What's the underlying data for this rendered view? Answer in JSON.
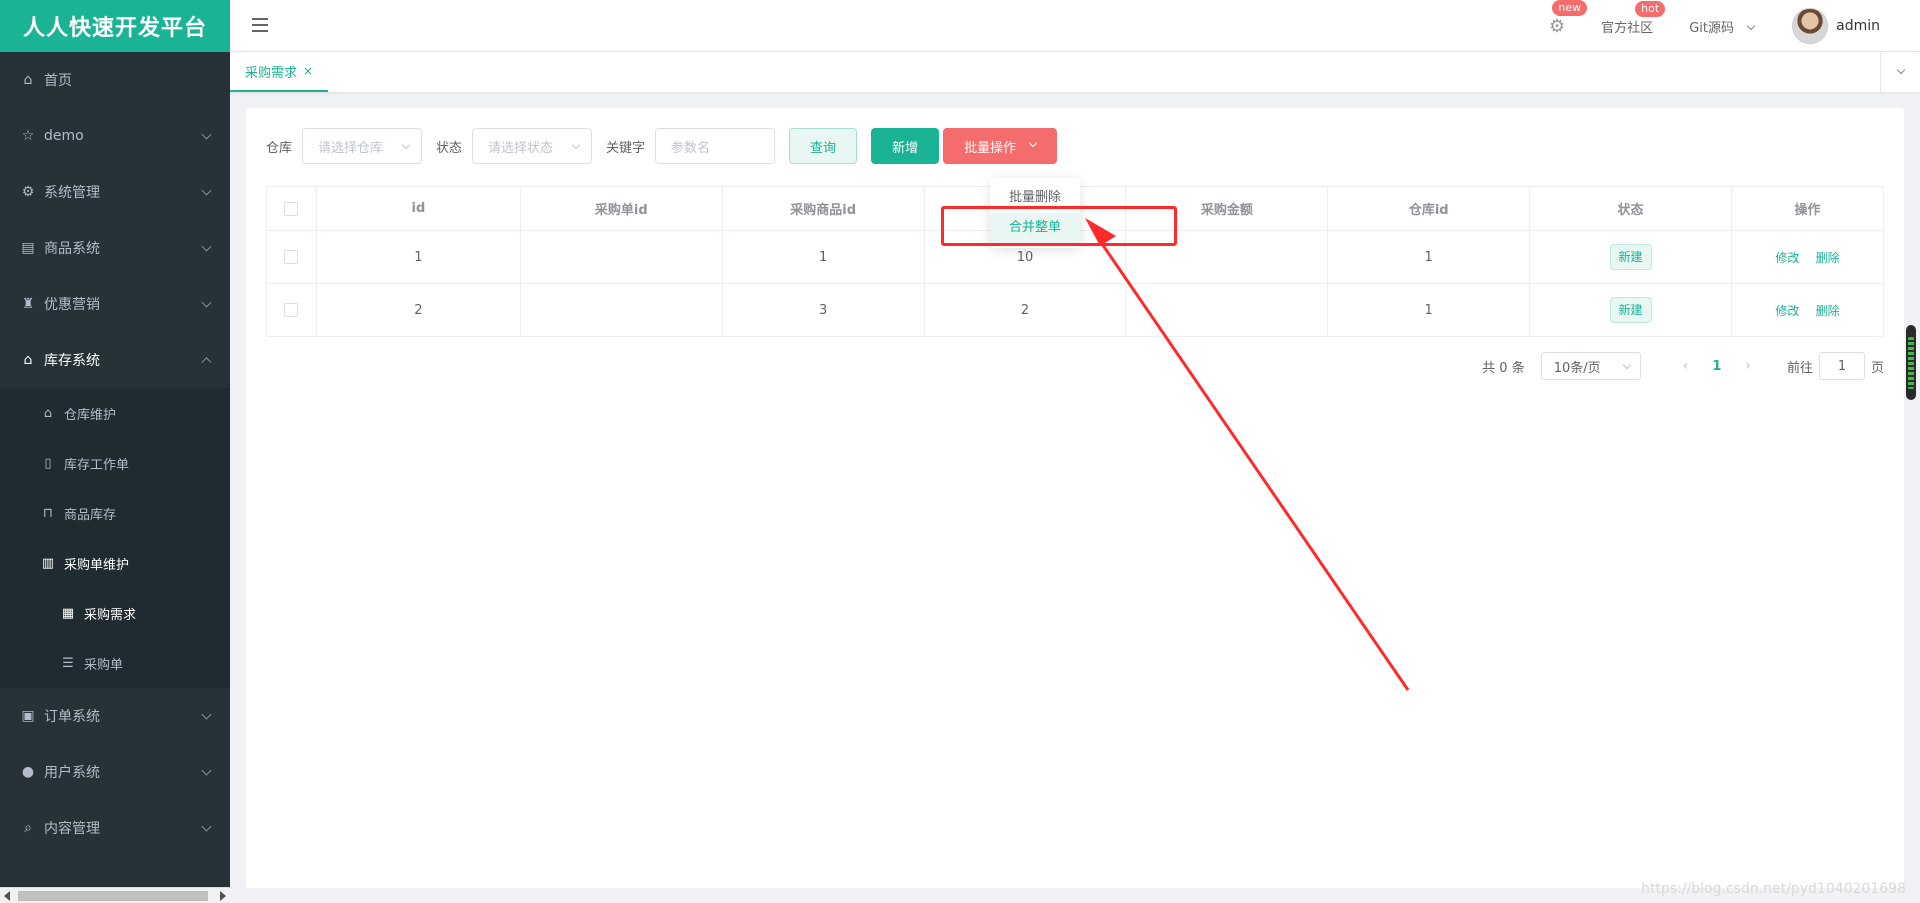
{
  "brand": "人人快速开发平台",
  "sidebar": {
    "home": "首页",
    "demo": "demo",
    "system": "系统管理",
    "goods": "商品系统",
    "promo": "优惠营销",
    "inventory": "库存系统",
    "warehouse": "仓库维护",
    "workorder": "库存工作单",
    "stock": "商品库存",
    "purchase_maint": "采购单维护",
    "purchase_req": "采购需求",
    "purchase_order": "采购单",
    "order": "订单系统",
    "user": "用户系统",
    "content": "内容管理"
  },
  "header": {
    "badge_new": "new",
    "community": "官方社区",
    "badge_hot": "hot",
    "git": "Git源码",
    "user": "admin"
  },
  "tabs": {
    "active": "采购需求",
    "close": "×"
  },
  "filters": {
    "warehouse_label": "仓库",
    "warehouse_placeholder": "请选择仓库",
    "status_label": "状态",
    "status_placeholder": "请选择状态",
    "keyword_label": "关键字",
    "keyword_placeholder": "参数名",
    "query": "查询",
    "add": "新增",
    "batch": "批量操作"
  },
  "dropdown": {
    "items": [
      "批量删除",
      "合并整单"
    ]
  },
  "table": {
    "headers": [
      "id",
      "采购单id",
      "采购商品id",
      "",
      "采购金额",
      "仓库id",
      "状态",
      "操作"
    ],
    "rows": [
      {
        "id": "1",
        "purchase_id": "",
        "sku_id": "1",
        "num": "10",
        "amount": "",
        "ware_id": "1",
        "status": "新建",
        "edit": "修改",
        "del": "删除"
      },
      {
        "id": "2",
        "purchase_id": "",
        "sku_id": "3",
        "num": "2",
        "amount": "",
        "ware_id": "1",
        "status": "新建",
        "edit": "修改",
        "del": "删除"
      }
    ]
  },
  "pager": {
    "total": "共 0 条",
    "size": "10条/页",
    "prev": "‹",
    "current": "1",
    "next": "›",
    "goto": "前往",
    "goto_value": "1",
    "page_unit": "页"
  },
  "watermark": "https://blog.csdn.net/pyd1040201698"
}
